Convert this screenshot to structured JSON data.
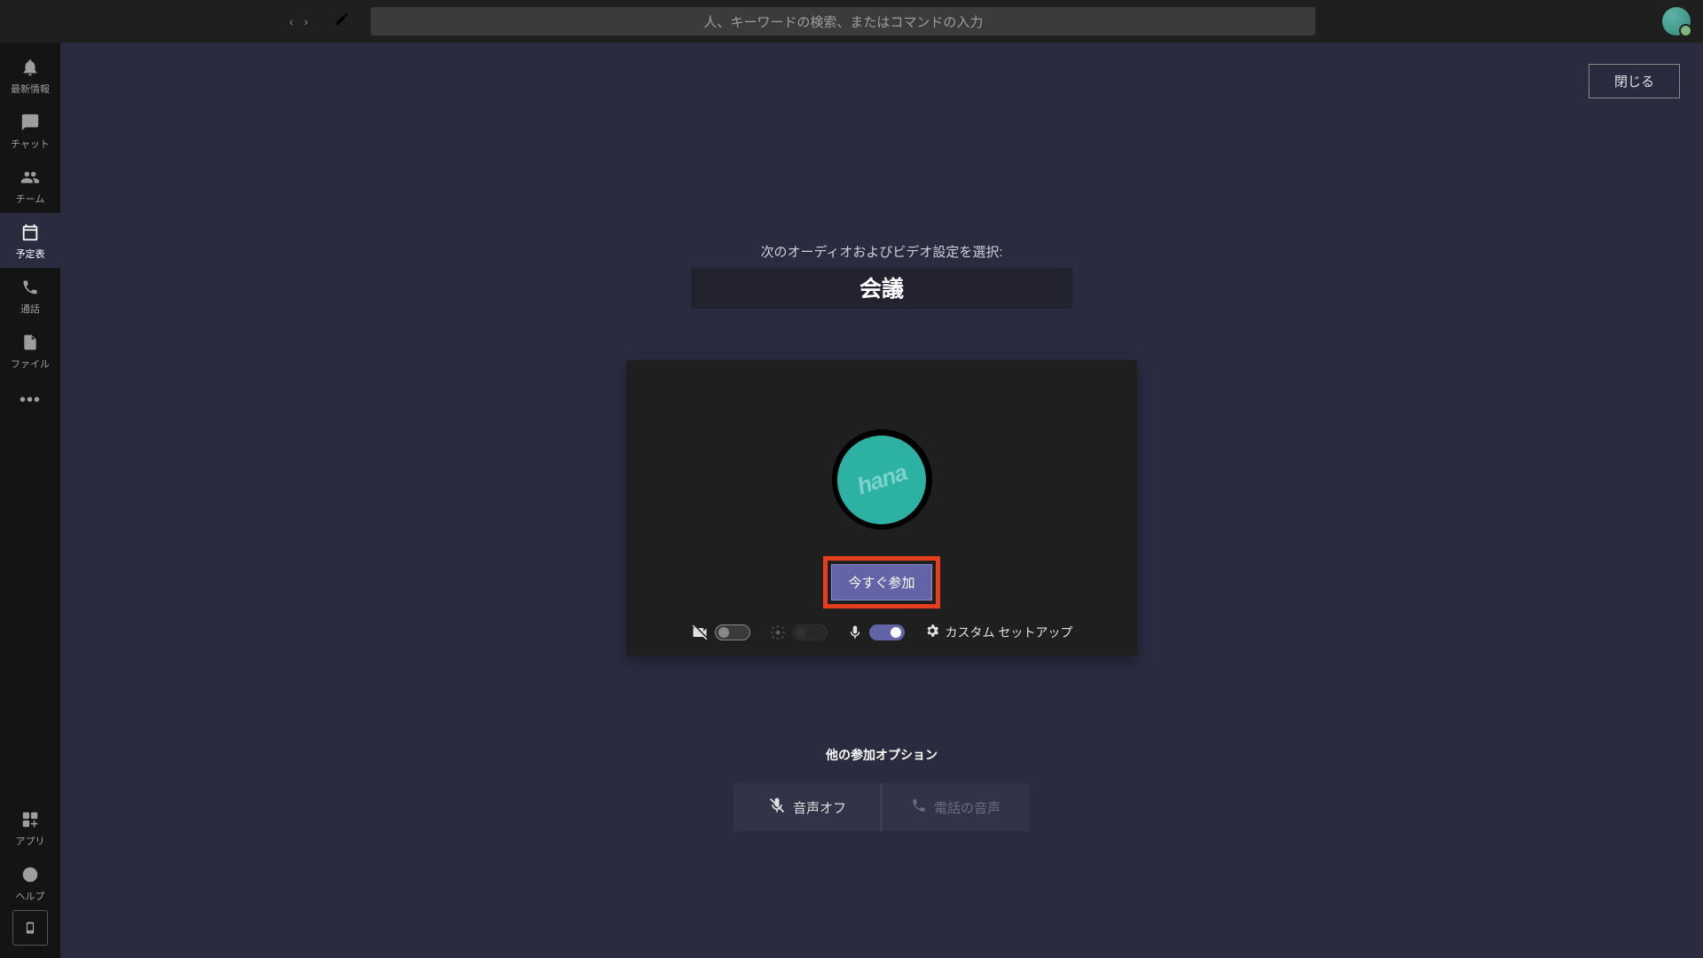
{
  "topbar": {
    "search_placeholder": "人、キーワードの検索、またはコマンドの入力"
  },
  "rail": {
    "activity": "最新情報",
    "chat": "チャット",
    "teams": "チーム",
    "calendar": "予定表",
    "calls": "通話",
    "files": "ファイル",
    "apps": "アプリ",
    "help": "ヘルプ"
  },
  "content": {
    "close": "閉じる",
    "prompt": "次のオーディオおよびビデオ設定を選択:",
    "meeting_title": "会議",
    "avatar_name": "hana",
    "join_now": "今すぐ参加",
    "custom_setup": "カスタム セットアップ",
    "other_title": "他の参加オプション",
    "audio_off": "音声オフ",
    "phone_audio": "電話の音声"
  }
}
